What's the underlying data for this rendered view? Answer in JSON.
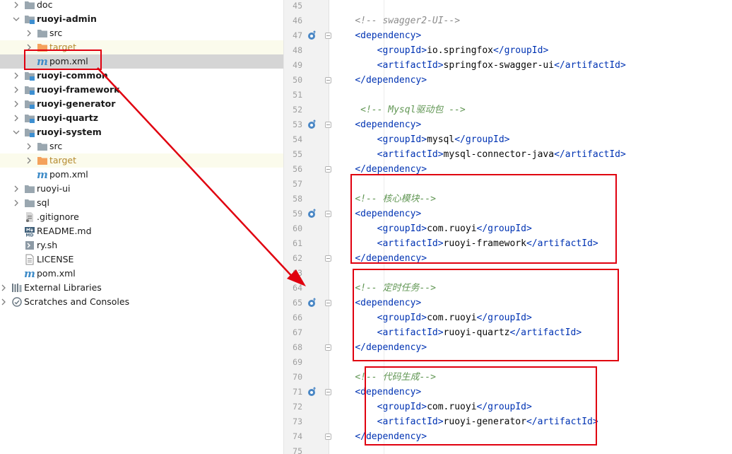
{
  "project_tree": [
    {
      "label": "doc",
      "indent": 1,
      "arrow": "right",
      "icon": "folder",
      "bold": false
    },
    {
      "label": "ruoyi-admin",
      "indent": 1,
      "arrow": "down",
      "icon": "module-folder",
      "bold": true
    },
    {
      "label": "src",
      "indent": 2,
      "arrow": "right",
      "icon": "folder",
      "bold": false
    },
    {
      "label": "target",
      "indent": 2,
      "arrow": "right",
      "icon": "excluded-folder",
      "bold": false,
      "muted": true
    },
    {
      "label": "pom.xml",
      "indent": 2,
      "arrow": "none",
      "icon": "maven",
      "bold": false,
      "selected": true
    },
    {
      "label": "ruoyi-common",
      "indent": 1,
      "arrow": "right",
      "icon": "module-folder",
      "bold": true
    },
    {
      "label": "ruoyi-framework",
      "indent": 1,
      "arrow": "right",
      "icon": "module-folder",
      "bold": true
    },
    {
      "label": "ruoyi-generator",
      "indent": 1,
      "arrow": "right",
      "icon": "module-folder",
      "bold": true
    },
    {
      "label": "ruoyi-quartz",
      "indent": 1,
      "arrow": "right",
      "icon": "module-folder",
      "bold": true
    },
    {
      "label": "ruoyi-system",
      "indent": 1,
      "arrow": "down",
      "icon": "module-folder",
      "bold": true
    },
    {
      "label": "src",
      "indent": 2,
      "arrow": "right",
      "icon": "folder",
      "bold": false
    },
    {
      "label": "target",
      "indent": 2,
      "arrow": "right",
      "icon": "excluded-folder",
      "bold": false,
      "muted": true
    },
    {
      "label": "pom.xml",
      "indent": 2,
      "arrow": "none",
      "icon": "maven",
      "bold": false
    },
    {
      "label": "ruoyi-ui",
      "indent": 1,
      "arrow": "right",
      "icon": "folder",
      "bold": false
    },
    {
      "label": "sql",
      "indent": 1,
      "arrow": "right",
      "icon": "folder",
      "bold": false
    },
    {
      "label": ".gitignore",
      "indent": 1,
      "arrow": "none",
      "icon": "gitignore-file",
      "bold": false
    },
    {
      "label": "README.md",
      "indent": 1,
      "arrow": "none",
      "icon": "markdown-file",
      "bold": false
    },
    {
      "label": "ry.sh",
      "indent": 1,
      "arrow": "none",
      "icon": "shell-file",
      "bold": false
    },
    {
      "label": "LICENSE",
      "indent": 1,
      "arrow": "none",
      "icon": "text-file",
      "bold": false
    },
    {
      "label": "pom.xml",
      "indent": 1,
      "arrow": "none",
      "icon": "maven",
      "bold": false
    },
    {
      "label": "External Libraries",
      "indent": 0,
      "arrow": "right",
      "icon": "libraries",
      "bold": false
    },
    {
      "label": "Scratches and Consoles",
      "indent": 0,
      "arrow": "right",
      "icon": "scratches",
      "bold": false
    }
  ],
  "editor": {
    "lines": [
      {
        "num": "45",
        "segments": []
      },
      {
        "num": "46",
        "segments": [
          {
            "t": "    ",
            "c": "txt"
          },
          {
            "t": "<!-- swagger2-UI-->",
            "c": "comment"
          }
        ]
      },
      {
        "num": "47",
        "gutter": "override",
        "fold": true,
        "segments": [
          {
            "t": "    ",
            "c": "txt"
          },
          {
            "t": "<dependency>",
            "c": "tag"
          }
        ]
      },
      {
        "num": "48",
        "segments": [
          {
            "t": "        ",
            "c": "txt"
          },
          {
            "t": "<groupId>",
            "c": "tag"
          },
          {
            "t": "io.springfox",
            "c": "txt"
          },
          {
            "t": "</groupId>",
            "c": "tag"
          }
        ]
      },
      {
        "num": "49",
        "segments": [
          {
            "t": "        ",
            "c": "txt"
          },
          {
            "t": "<artifactId>",
            "c": "tag"
          },
          {
            "t": "springfox-swagger-ui",
            "c": "txt"
          },
          {
            "t": "</artifactId>",
            "c": "tag"
          }
        ]
      },
      {
        "num": "50",
        "fold": true,
        "segments": [
          {
            "t": "    ",
            "c": "txt"
          },
          {
            "t": "</dependency>",
            "c": "tag"
          }
        ]
      },
      {
        "num": "51",
        "segments": []
      },
      {
        "num": "52",
        "segments": [
          {
            "t": "     ",
            "c": "txt"
          },
          {
            "t": "<!-- Mysql驱动包 -->",
            "c": "cmt-green"
          }
        ]
      },
      {
        "num": "53",
        "gutter": "override",
        "fold": true,
        "segments": [
          {
            "t": "    ",
            "c": "txt"
          },
          {
            "t": "<dependency>",
            "c": "tag"
          }
        ]
      },
      {
        "num": "54",
        "segments": [
          {
            "t": "        ",
            "c": "txt"
          },
          {
            "t": "<groupId>",
            "c": "tag"
          },
          {
            "t": "mysql",
            "c": "txt"
          },
          {
            "t": "</groupId>",
            "c": "tag"
          }
        ]
      },
      {
        "num": "55",
        "segments": [
          {
            "t": "        ",
            "c": "txt"
          },
          {
            "t": "<artifactId>",
            "c": "tag"
          },
          {
            "t": "mysql-connector-java",
            "c": "txt"
          },
          {
            "t": "</artifactId>",
            "c": "tag"
          }
        ]
      },
      {
        "num": "56",
        "fold": true,
        "segments": [
          {
            "t": "    ",
            "c": "txt"
          },
          {
            "t": "</dependency>",
            "c": "tag"
          }
        ]
      },
      {
        "num": "57",
        "segments": []
      },
      {
        "num": "58",
        "segments": [
          {
            "t": "    ",
            "c": "txt"
          },
          {
            "t": "<!-- 核心模块-->",
            "c": "cmt-green"
          }
        ]
      },
      {
        "num": "59",
        "gutter": "override",
        "fold": true,
        "segments": [
          {
            "t": "    ",
            "c": "txt"
          },
          {
            "t": "<dependency>",
            "c": "tag"
          }
        ]
      },
      {
        "num": "60",
        "segments": [
          {
            "t": "        ",
            "c": "txt"
          },
          {
            "t": "<groupId>",
            "c": "tag"
          },
          {
            "t": "com.ruoyi",
            "c": "txt"
          },
          {
            "t": "</groupId>",
            "c": "tag"
          }
        ]
      },
      {
        "num": "61",
        "segments": [
          {
            "t": "        ",
            "c": "txt"
          },
          {
            "t": "<artifactId>",
            "c": "tag"
          },
          {
            "t": "ruoyi-framework",
            "c": "txt"
          },
          {
            "t": "</artifactId>",
            "c": "tag"
          }
        ]
      },
      {
        "num": "62",
        "fold": true,
        "segments": [
          {
            "t": "    ",
            "c": "txt"
          },
          {
            "t": "</dependency>",
            "c": "tag"
          }
        ]
      },
      {
        "num": "63",
        "segments": []
      },
      {
        "num": "64",
        "segments": [
          {
            "t": "    ",
            "c": "txt"
          },
          {
            "t": "<!-- 定时任务-->",
            "c": "cmt-green"
          }
        ]
      },
      {
        "num": "65",
        "gutter": "override",
        "fold": true,
        "segments": [
          {
            "t": "    ",
            "c": "txt"
          },
          {
            "t": "<dependency>",
            "c": "tag"
          }
        ]
      },
      {
        "num": "66",
        "segments": [
          {
            "t": "        ",
            "c": "txt"
          },
          {
            "t": "<groupId>",
            "c": "tag"
          },
          {
            "t": "com.ruoyi",
            "c": "txt"
          },
          {
            "t": "</groupId>",
            "c": "tag"
          }
        ]
      },
      {
        "num": "67",
        "segments": [
          {
            "t": "        ",
            "c": "txt"
          },
          {
            "t": "<artifactId>",
            "c": "tag"
          },
          {
            "t": "ruoyi-quartz",
            "c": "txt"
          },
          {
            "t": "</artifactId>",
            "c": "tag"
          }
        ]
      },
      {
        "num": "68",
        "fold": true,
        "segments": [
          {
            "t": "    ",
            "c": "txt"
          },
          {
            "t": "</dependency>",
            "c": "tag"
          }
        ]
      },
      {
        "num": "69",
        "segments": []
      },
      {
        "num": "70",
        "segments": [
          {
            "t": "    ",
            "c": "txt"
          },
          {
            "t": "<!-- 代码生成-->",
            "c": "cmt-green"
          }
        ]
      },
      {
        "num": "71",
        "gutter": "override",
        "fold": true,
        "segments": [
          {
            "t": "    ",
            "c": "txt"
          },
          {
            "t": "<dependency>",
            "c": "tag"
          }
        ]
      },
      {
        "num": "72",
        "segments": [
          {
            "t": "        ",
            "c": "txt"
          },
          {
            "t": "<groupId>",
            "c": "tag"
          },
          {
            "t": "com.ruoyi",
            "c": "txt"
          },
          {
            "t": "</groupId>",
            "c": "tag"
          }
        ]
      },
      {
        "num": "73",
        "segments": [
          {
            "t": "        ",
            "c": "txt"
          },
          {
            "t": "<artifactId>",
            "c": "tag"
          },
          {
            "t": "ruoyi-generator",
            "c": "txt"
          },
          {
            "t": "</artifactId>",
            "c": "tag"
          }
        ]
      },
      {
        "num": "74",
        "fold": true,
        "segments": [
          {
            "t": "    ",
            "c": "txt"
          },
          {
            "t": "</dependency>",
            "c": "tag"
          }
        ]
      },
      {
        "num": "75",
        "segments": []
      }
    ]
  },
  "colors": {
    "annotation_red": "#e0000f",
    "tag_blue": "#0033b3",
    "comment_green": "#629755",
    "comment_gray": "#8c8c8c",
    "selection_gray": "#d5d5d5",
    "excluded_bg": "#fbfbec"
  }
}
